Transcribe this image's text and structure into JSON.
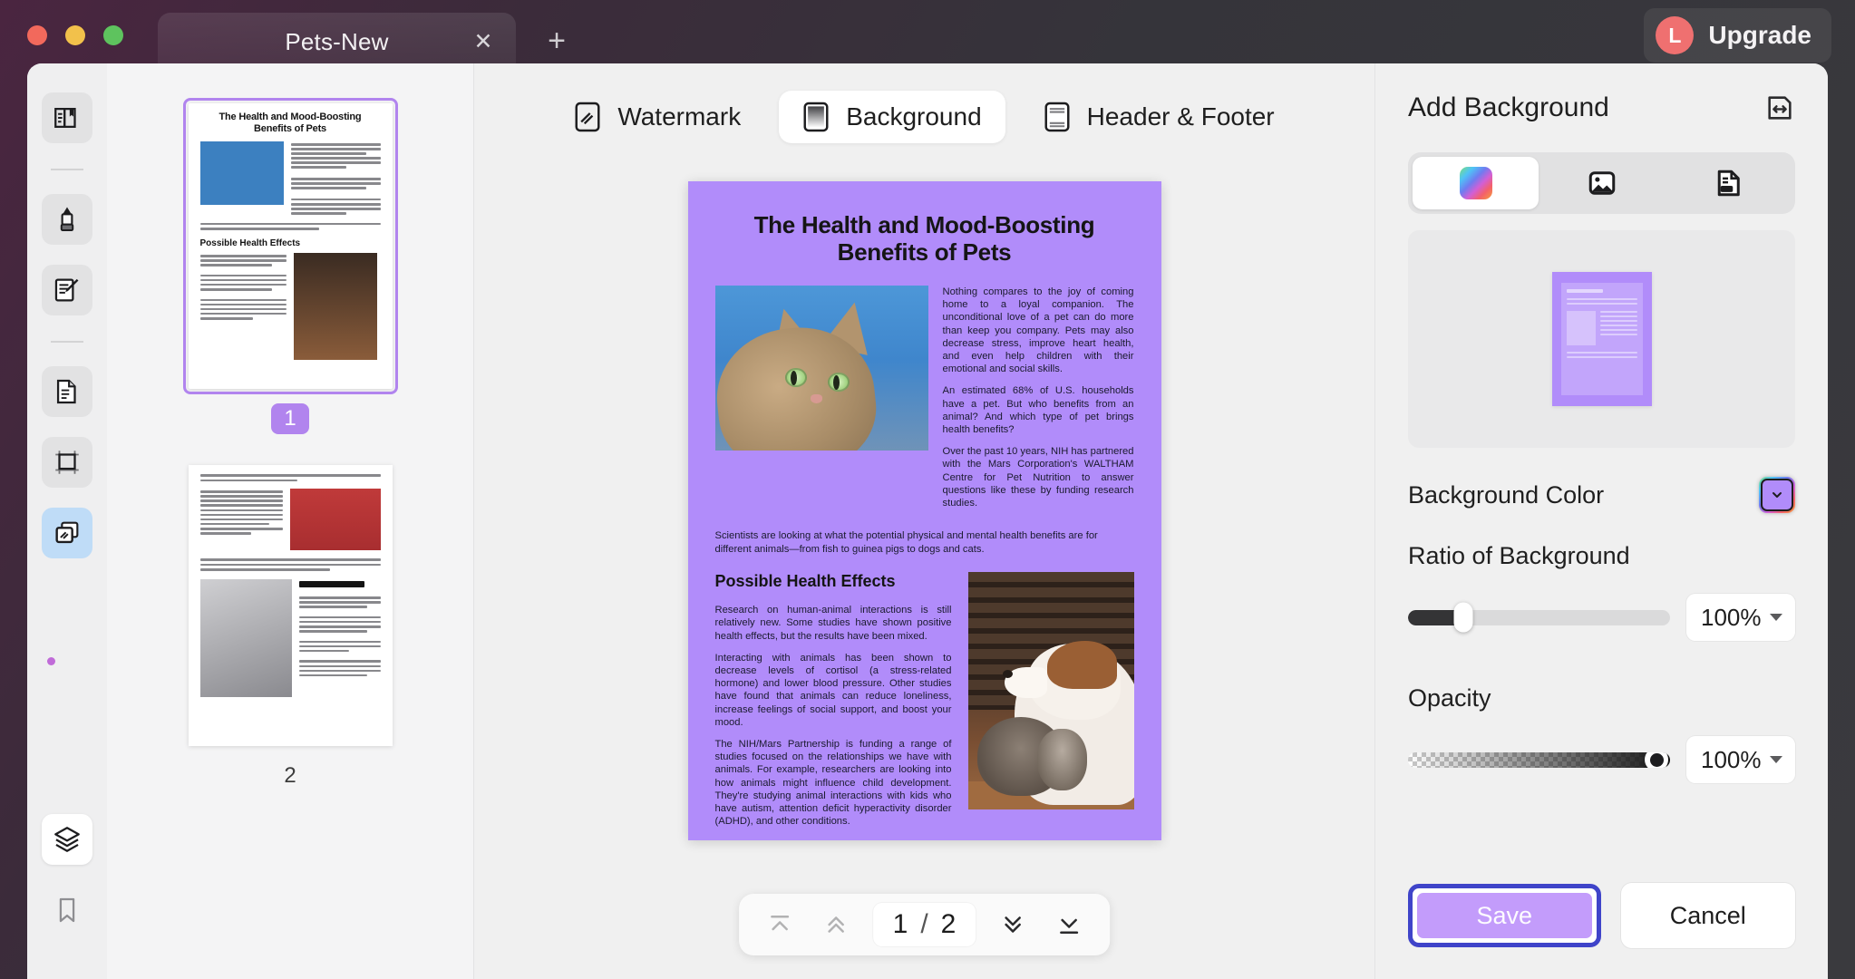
{
  "titlebar": {
    "tab_title": "Pets-New",
    "close_label": "✕",
    "new_tab_label": "+",
    "avatar_initial": "L",
    "upgrade_label": "Upgrade"
  },
  "rail": {
    "items": [
      {
        "name": "reader-view",
        "icon": "book-icon",
        "active": false
      },
      {
        "name": "highlighter",
        "icon": "highlighter-icon",
        "active": false
      },
      {
        "name": "edit-document",
        "icon": "edit-document-icon",
        "active": false
      },
      {
        "name": "organize-pages",
        "icon": "pages-icon",
        "active": false
      },
      {
        "name": "crop-page",
        "icon": "crop-icon",
        "active": false
      },
      {
        "name": "watermark-background",
        "icon": "watermark-icon",
        "active": true
      },
      {
        "name": "layers",
        "icon": "layers-icon",
        "active": false
      },
      {
        "name": "bookmark",
        "icon": "bookmark-icon",
        "active": false
      }
    ]
  },
  "thumbnails": {
    "pages": [
      {
        "number": "1",
        "selected": true
      },
      {
        "number": "2",
        "selected": false
      }
    ]
  },
  "mode_tabs": [
    {
      "label": "Watermark",
      "icon": "watermark-icon",
      "active": false
    },
    {
      "label": "Background",
      "icon": "background-icon",
      "active": true
    },
    {
      "label": "Header & Footer",
      "icon": "header-footer-icon",
      "active": false
    }
  ],
  "document": {
    "title": "The Health and Mood-Boosting Benefits of Pets",
    "background_color": "#b18cfa",
    "paragraphs": [
      "Nothing compares to the joy of coming home to a loyal companion. The unconditional love of a pet can do more than keep you company. Pets may also decrease stress, improve heart health, and even help children with their emotional and social skills.",
      "An estimated 68% of U.S. households have a pet. But who benefits from an animal? And which type of pet brings health benefits?",
      "Over the past 10 years, NIH has partnered with the Mars Corporation's WALTHAM Centre for Pet Nutrition to answer questions like these by funding research studies."
    ],
    "wide_paragraph": "Scientists are looking at what the potential physical and mental health benefits are for different animals—from fish to guinea pigs to dogs and cats.",
    "section_heading": "Possible Health Effects",
    "section_paragraphs": [
      "Research on human-animal interactions is still relatively new. Some studies have shown positive health effects, but the results have been mixed.",
      "Interacting with animals has been shown to decrease levels of cortisol (a stress-related hormone) and lower blood pressure. Other studies have found that animals can reduce loneliness, increase feelings of social support, and boost your mood.",
      "The NIH/Mars Partnership is funding a range of studies focused on the relationships we have with animals. For example, researchers are looking into how animals might influence child development. They're studying animal interactions with kids who have autism, attention deficit hyperactivity disorder (ADHD), and other conditions."
    ]
  },
  "page_nav": {
    "first_icon": "first-page-icon",
    "prev_icon": "previous-page-icon",
    "current_page": "1",
    "separator": "/",
    "total_pages": "2",
    "next_icon": "next-page-icon",
    "last_icon": "last-page-icon"
  },
  "panel": {
    "title": "Add Background",
    "expand_icon": "expand-panel-icon",
    "source_tabs": [
      {
        "name": "color",
        "icon": "color-gradient-icon",
        "active": true
      },
      {
        "name": "image",
        "icon": "image-icon",
        "active": false
      },
      {
        "name": "file",
        "icon": "file-icon",
        "active": false
      }
    ],
    "background_color_label": "Background Color",
    "background_color_value": "#b18cfa",
    "ratio_label": "Ratio of Background",
    "ratio_value": "100%",
    "ratio_thumb_percent": 21,
    "opacity_label": "Opacity",
    "opacity_value": "100%",
    "opacity_thumb_percent": 100,
    "save_label": "Save",
    "cancel_label": "Cancel"
  }
}
